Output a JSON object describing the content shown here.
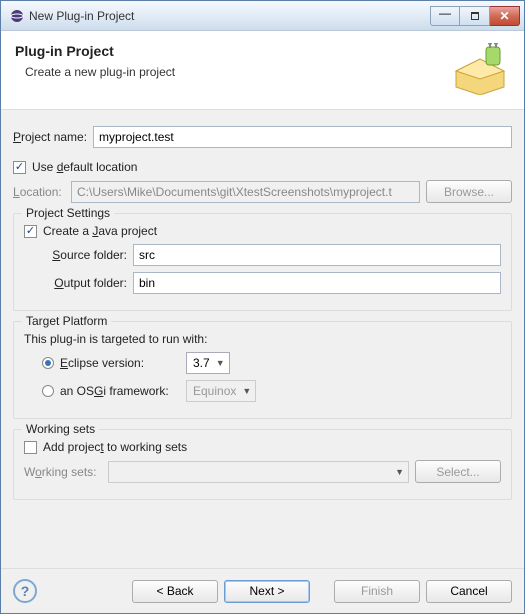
{
  "window": {
    "title": "New Plug-in Project"
  },
  "header": {
    "title": "Plug-in Project",
    "subtitle": "Create a new plug-in project"
  },
  "projectName": {
    "label": "Project name:",
    "value": "myproject.test"
  },
  "location": {
    "useDefaultLabel": "Use default location",
    "useDefaultChecked": true,
    "label": "Location:",
    "value": "C:\\Users\\Mike\\Documents\\git\\XtestScreenshots\\myproject.t",
    "browse": "Browse..."
  },
  "projectSettings": {
    "legend": "Project Settings",
    "createJavaLabel": "Create a Java project",
    "createJavaChecked": true,
    "sourceFolderLabel": "Source folder:",
    "sourceFolderValue": "src",
    "outputFolderLabel": "Output folder:",
    "outputFolderValue": "bin"
  },
  "targetPlatform": {
    "legend": "Target Platform",
    "intro": "This plug-in is targeted to run with:",
    "eclipseLabel": "Eclipse version:",
    "eclipseSelected": true,
    "eclipseVersion": "3.7",
    "osgiLabel": "an OSGi framework:",
    "osgiValue": "Equinox"
  },
  "workingSets": {
    "legend": "Working sets",
    "addLabel": "Add project to working sets",
    "addChecked": false,
    "label": "Working sets:",
    "value": "",
    "select": "Select..."
  },
  "buttons": {
    "back": "< Back",
    "next": "Next >",
    "finish": "Finish",
    "cancel": "Cancel"
  }
}
